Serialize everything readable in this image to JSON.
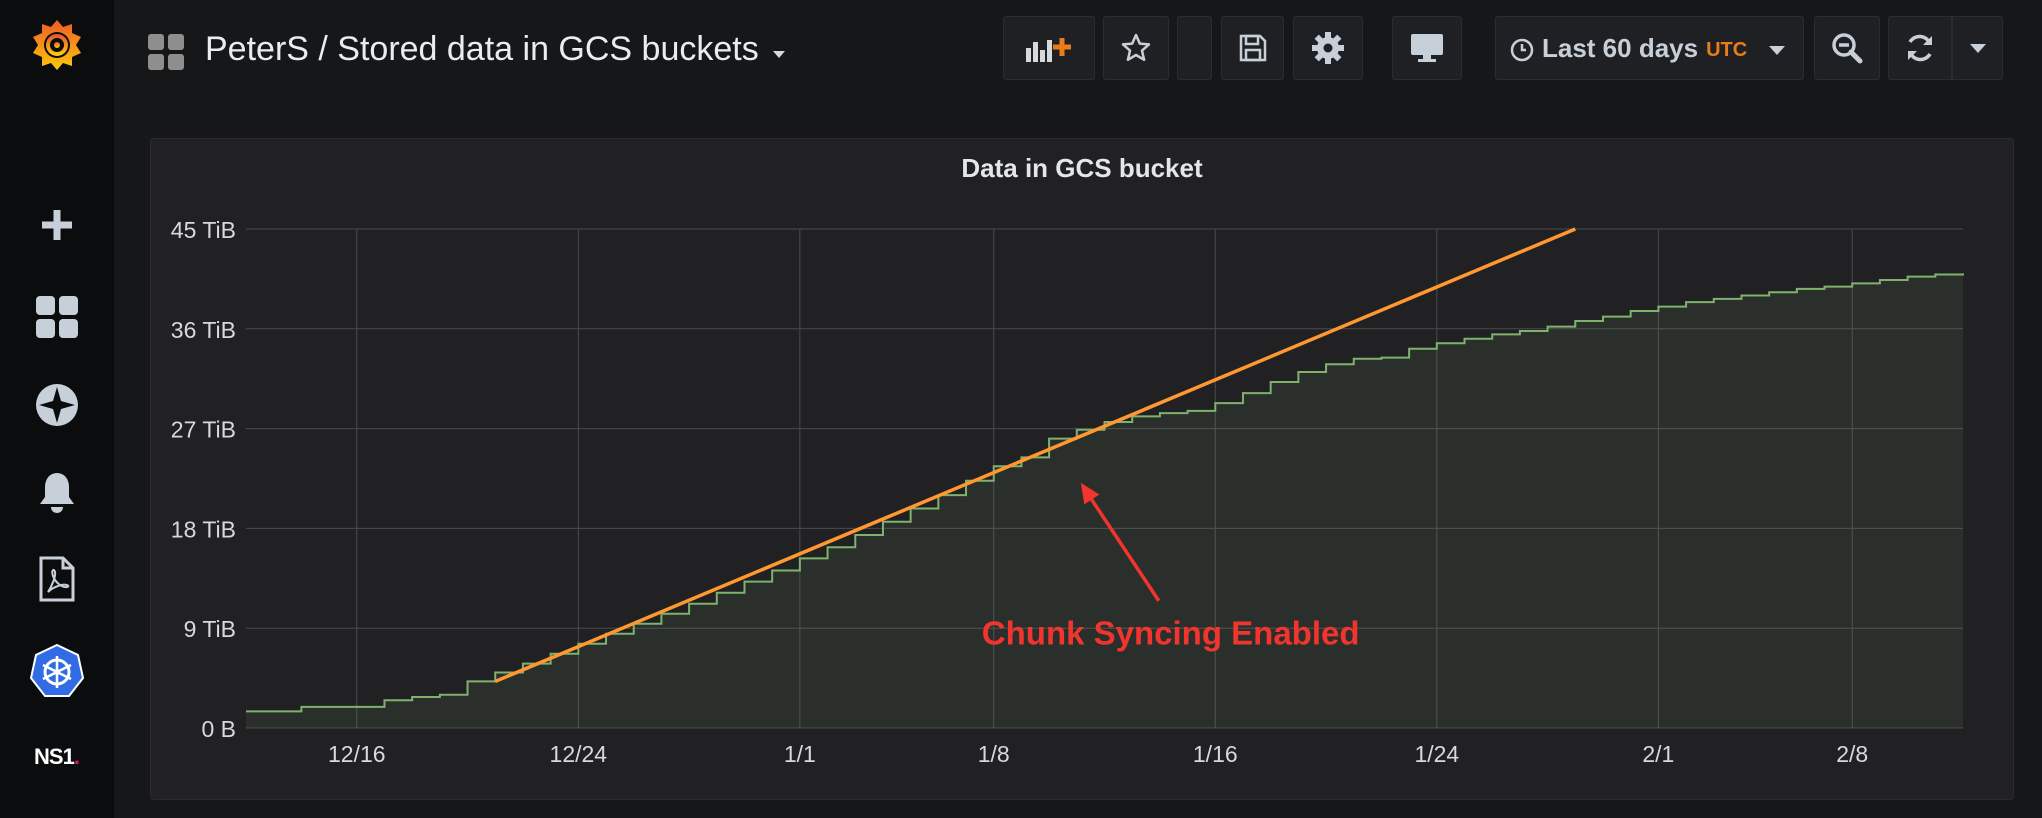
{
  "sidebar": {
    "items": [
      {
        "name": "grafana-logo-icon"
      },
      {
        "name": "plus-icon"
      },
      {
        "name": "dashboards-icon"
      },
      {
        "name": "explore-icon"
      },
      {
        "name": "alerting-bell-icon"
      },
      {
        "name": "pdf-report-icon"
      },
      {
        "name": "kubernetes-icon"
      },
      {
        "name": "ns1-icon",
        "label": "NS1"
      }
    ]
  },
  "header": {
    "title": "PeterS / Stored data in GCS buckets",
    "time_range": "Last 60 days",
    "timezone": "UTC"
  },
  "toolbar": {
    "buttons": [
      "add-panel-icon",
      "star-icon",
      "empty-slot",
      "save-icon",
      "gear-icon",
      "monitor-icon",
      "zoom-out-icon",
      "refresh-icon",
      "chevron-down-icon"
    ]
  },
  "colors": {
    "series": "#7eb26d",
    "trend": "#ff9830",
    "annotation": "#f2342f",
    "time_accent": "#eb7b18"
  },
  "panel": {
    "title": "Data in GCS bucket",
    "annotation_text": "Chunk Syncing Enabled"
  },
  "chart_data": {
    "type": "area",
    "title": "Data in GCS bucket",
    "yunit": "TiB",
    "ylim": [
      0,
      45
    ],
    "yticks": [
      0,
      9,
      18,
      27,
      36,
      45
    ],
    "ytick_labels": [
      "0 B",
      "9 TiB",
      "18 TiB",
      "27 TiB",
      "36 TiB",
      "45 TiB"
    ],
    "xlim": [
      "2018-12-12",
      "2019-02-12"
    ],
    "xticks": [
      "2018-12-16",
      "2018-12-24",
      "2019-01-01",
      "2019-01-08",
      "2019-01-16",
      "2019-01-24",
      "2019-02-01",
      "2019-02-08"
    ],
    "xtick_labels": [
      "12/16",
      "12/24",
      "1/1",
      "1/8",
      "1/16",
      "1/24",
      "2/1",
      "2/8"
    ],
    "grid": true,
    "series": [
      {
        "x": [
          "2018-12-12",
          "2018-12-14",
          "2018-12-15",
          "2018-12-17",
          "2018-12-18",
          "2018-12-19",
          "2018-12-20",
          "2018-12-21",
          "2018-12-22",
          "2018-12-23",
          "2018-12-24",
          "2018-12-25",
          "2018-12-26",
          "2018-12-27",
          "2018-12-28",
          "2018-12-29",
          "2018-12-30",
          "2018-12-31",
          "2019-01-01",
          "2019-01-02",
          "2019-01-03",
          "2019-01-04",
          "2019-01-05",
          "2019-01-06",
          "2019-01-07",
          "2019-01-08",
          "2019-01-09",
          "2019-01-10",
          "2019-01-11",
          "2019-01-12",
          "2019-01-13",
          "2019-01-14",
          "2019-01-15",
          "2019-01-16",
          "2019-01-17",
          "2019-01-18",
          "2019-01-19",
          "2019-01-20",
          "2019-01-21",
          "2019-01-22",
          "2019-01-23",
          "2019-01-24",
          "2019-01-25",
          "2019-01-26",
          "2019-01-27",
          "2019-01-28",
          "2019-01-29",
          "2019-01-30",
          "2019-01-31",
          "2019-02-01",
          "2019-02-02",
          "2019-02-03",
          "2019-02-04",
          "2019-02-05",
          "2019-02-06",
          "2019-02-07",
          "2019-02-08",
          "2019-02-09",
          "2019-02-10",
          "2019-02-11",
          "2019-02-12"
        ],
        "values": [
          1.5,
          1.9,
          1.9,
          2.5,
          2.8,
          3.0,
          4.2,
          5.0,
          5.8,
          6.7,
          7.6,
          8.5,
          9.4,
          10.3,
          11.2,
          12.2,
          13.2,
          14.2,
          15.3,
          16.3,
          17.4,
          18.6,
          19.8,
          21.0,
          22.3,
          23.6,
          24.4,
          26.1,
          26.9,
          27.6,
          28.1,
          28.4,
          28.6,
          29.3,
          30.2,
          31.2,
          32.1,
          32.8,
          33.3,
          33.4,
          34.2,
          34.7,
          35.1,
          35.5,
          35.8,
          36.2,
          36.7,
          37.1,
          37.6,
          38.0,
          38.4,
          38.7,
          39.0,
          39.3,
          39.6,
          39.8,
          40.1,
          40.4,
          40.7,
          40.9,
          41.0
        ]
      }
    ],
    "trend_line": {
      "x": [
        "2018-12-21",
        "2019-01-29"
      ],
      "y": [
        4.2,
        45.0
      ]
    },
    "annotation": {
      "text": "Chunk Syncing Enabled",
      "x": "2019-01-11",
      "y": 23.2
    }
  }
}
